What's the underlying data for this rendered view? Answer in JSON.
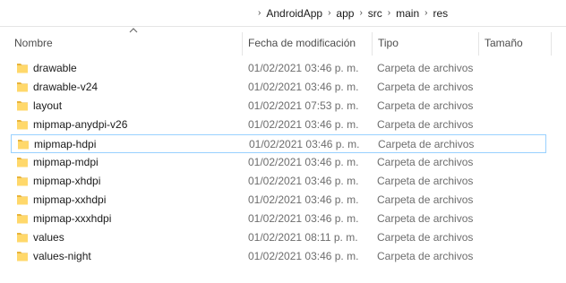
{
  "breadcrumb": {
    "items": [
      "AndroidApp",
      "app",
      "src",
      "main",
      "res"
    ]
  },
  "columns": {
    "name": "Nombre",
    "date": "Fecha de modificación",
    "type": "Tipo",
    "size": "Tamaño"
  },
  "icons": {
    "folder": "folder-icon",
    "separator": "chevron-right-icon",
    "sort": "sort-up-icon"
  },
  "colors": {
    "folder": "#ffd86b",
    "selection_border": "#99d1ff"
  },
  "selected_row": 4,
  "rows": [
    {
      "name": "drawable",
      "date": "01/02/2021 03:46 p. m.",
      "type": "Carpeta de archivos"
    },
    {
      "name": "drawable-v24",
      "date": "01/02/2021 03:46 p. m.",
      "type": "Carpeta de archivos"
    },
    {
      "name": "layout",
      "date": "01/02/2021 07:53 p. m.",
      "type": "Carpeta de archivos"
    },
    {
      "name": "mipmap-anydpi-v26",
      "date": "01/02/2021 03:46 p. m.",
      "type": "Carpeta de archivos"
    },
    {
      "name": "mipmap-hdpi",
      "date": "01/02/2021 03:46 p. m.",
      "type": "Carpeta de archivos"
    },
    {
      "name": "mipmap-mdpi",
      "date": "01/02/2021 03:46 p. m.",
      "type": "Carpeta de archivos"
    },
    {
      "name": "mipmap-xhdpi",
      "date": "01/02/2021 03:46 p. m.",
      "type": "Carpeta de archivos"
    },
    {
      "name": "mipmap-xxhdpi",
      "date": "01/02/2021 03:46 p. m.",
      "type": "Carpeta de archivos"
    },
    {
      "name": "mipmap-xxxhdpi",
      "date": "01/02/2021 03:46 p. m.",
      "type": "Carpeta de archivos"
    },
    {
      "name": "values",
      "date": "01/02/2021 08:11 p. m.",
      "type": "Carpeta de archivos"
    },
    {
      "name": "values-night",
      "date": "01/02/2021 03:46 p. m.",
      "type": "Carpeta de archivos"
    }
  ]
}
